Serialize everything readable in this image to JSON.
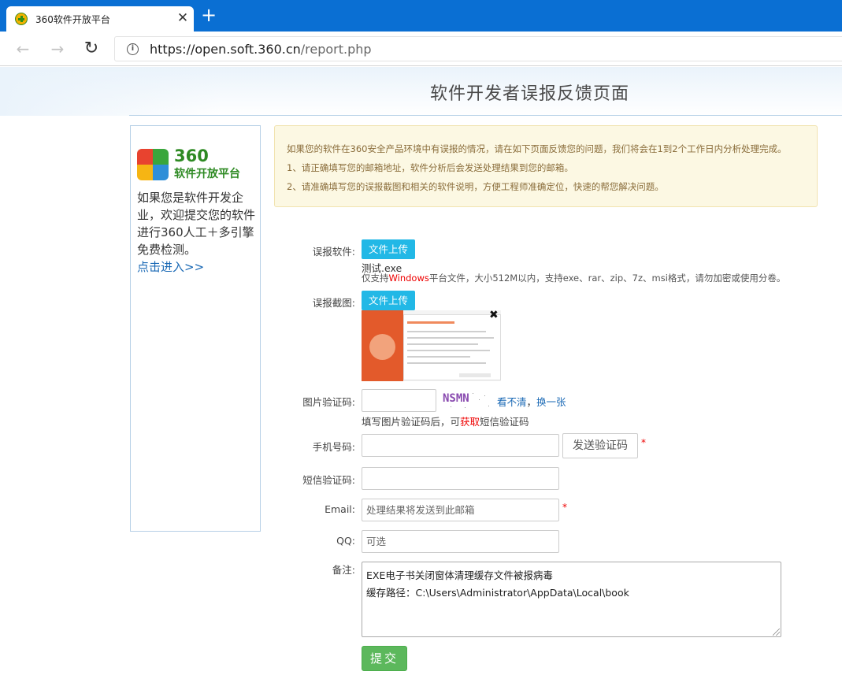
{
  "browser": {
    "tab_title": "360软件开放平台",
    "tab_close": "✕",
    "new_tab": "+",
    "url_host": "https://open.soft.360.cn",
    "url_path": "/report.php"
  },
  "header": {
    "title": "软件开发者误报反馈页面"
  },
  "sidebar": {
    "logo_number": "360",
    "logo_text": "软件开放平台",
    "description": "如果您是软件开发企业，欢迎提交您的软件进行360人工＋多引擎免费检测。",
    "link": "点击进入>>"
  },
  "notice": {
    "line1": "如果您的软件在360安全产品环境中有误报的情况，请在如下页面反馈您的问题，我们将会在1到2个工作日内分析处理完成。",
    "line2": "1、请正确填写您的邮箱地址，软件分析后会发送处理结果到您的邮箱。",
    "line3": "2、请准确填写您的误报截图和相关的软件说明，方便工程师准确定位，快速的帮您解决问题。"
  },
  "form": {
    "software_label": "误报软件:",
    "upload_button": "文件上传",
    "file_name": "测试.exe",
    "file_hint_pre": "仅支持",
    "file_hint_hl": "Windows",
    "file_hint_post": "平台文件，大小512M以内，支持exe、rar、zip、7z、msi格式，请勿加密或使用分卷。",
    "screenshot_label": "误报截图:",
    "screenshot_upload_button": "文件上传",
    "thumb_close": "✖",
    "captcha_label": "图片验证码:",
    "captcha_text": "NSMN",
    "captcha_unclear": "看不清",
    "captcha_sep": "，",
    "captcha_refresh": "换一张",
    "captcha_hint_pre": "填写图片验证码后，可",
    "captcha_hint_hl": "获取",
    "captcha_hint_post": "短信验证码",
    "phone_label": "手机号码:",
    "send_code_button": "发送验证码",
    "sms_label": "短信验证码:",
    "email_label": "Email:",
    "email_placeholder": "处理结果将发送到此邮箱",
    "qq_label": "QQ:",
    "qq_placeholder": "可选",
    "note_label": "备注:",
    "note_value": "EXE电子书关闭窗体清理缓存文件被报病毒\n缓存路径：C:\\Users\\Administrator\\AppData\\Local\\book",
    "required_mark": "*",
    "submit_button": "提交"
  },
  "colors": {
    "tabbar": "#0a6fd3",
    "upload_button": "#22b8e6",
    "submit_button": "#5cb85c",
    "link": "#1a69b5",
    "highlight": "#ee0000",
    "notice_bg": "#fcf8e3"
  }
}
